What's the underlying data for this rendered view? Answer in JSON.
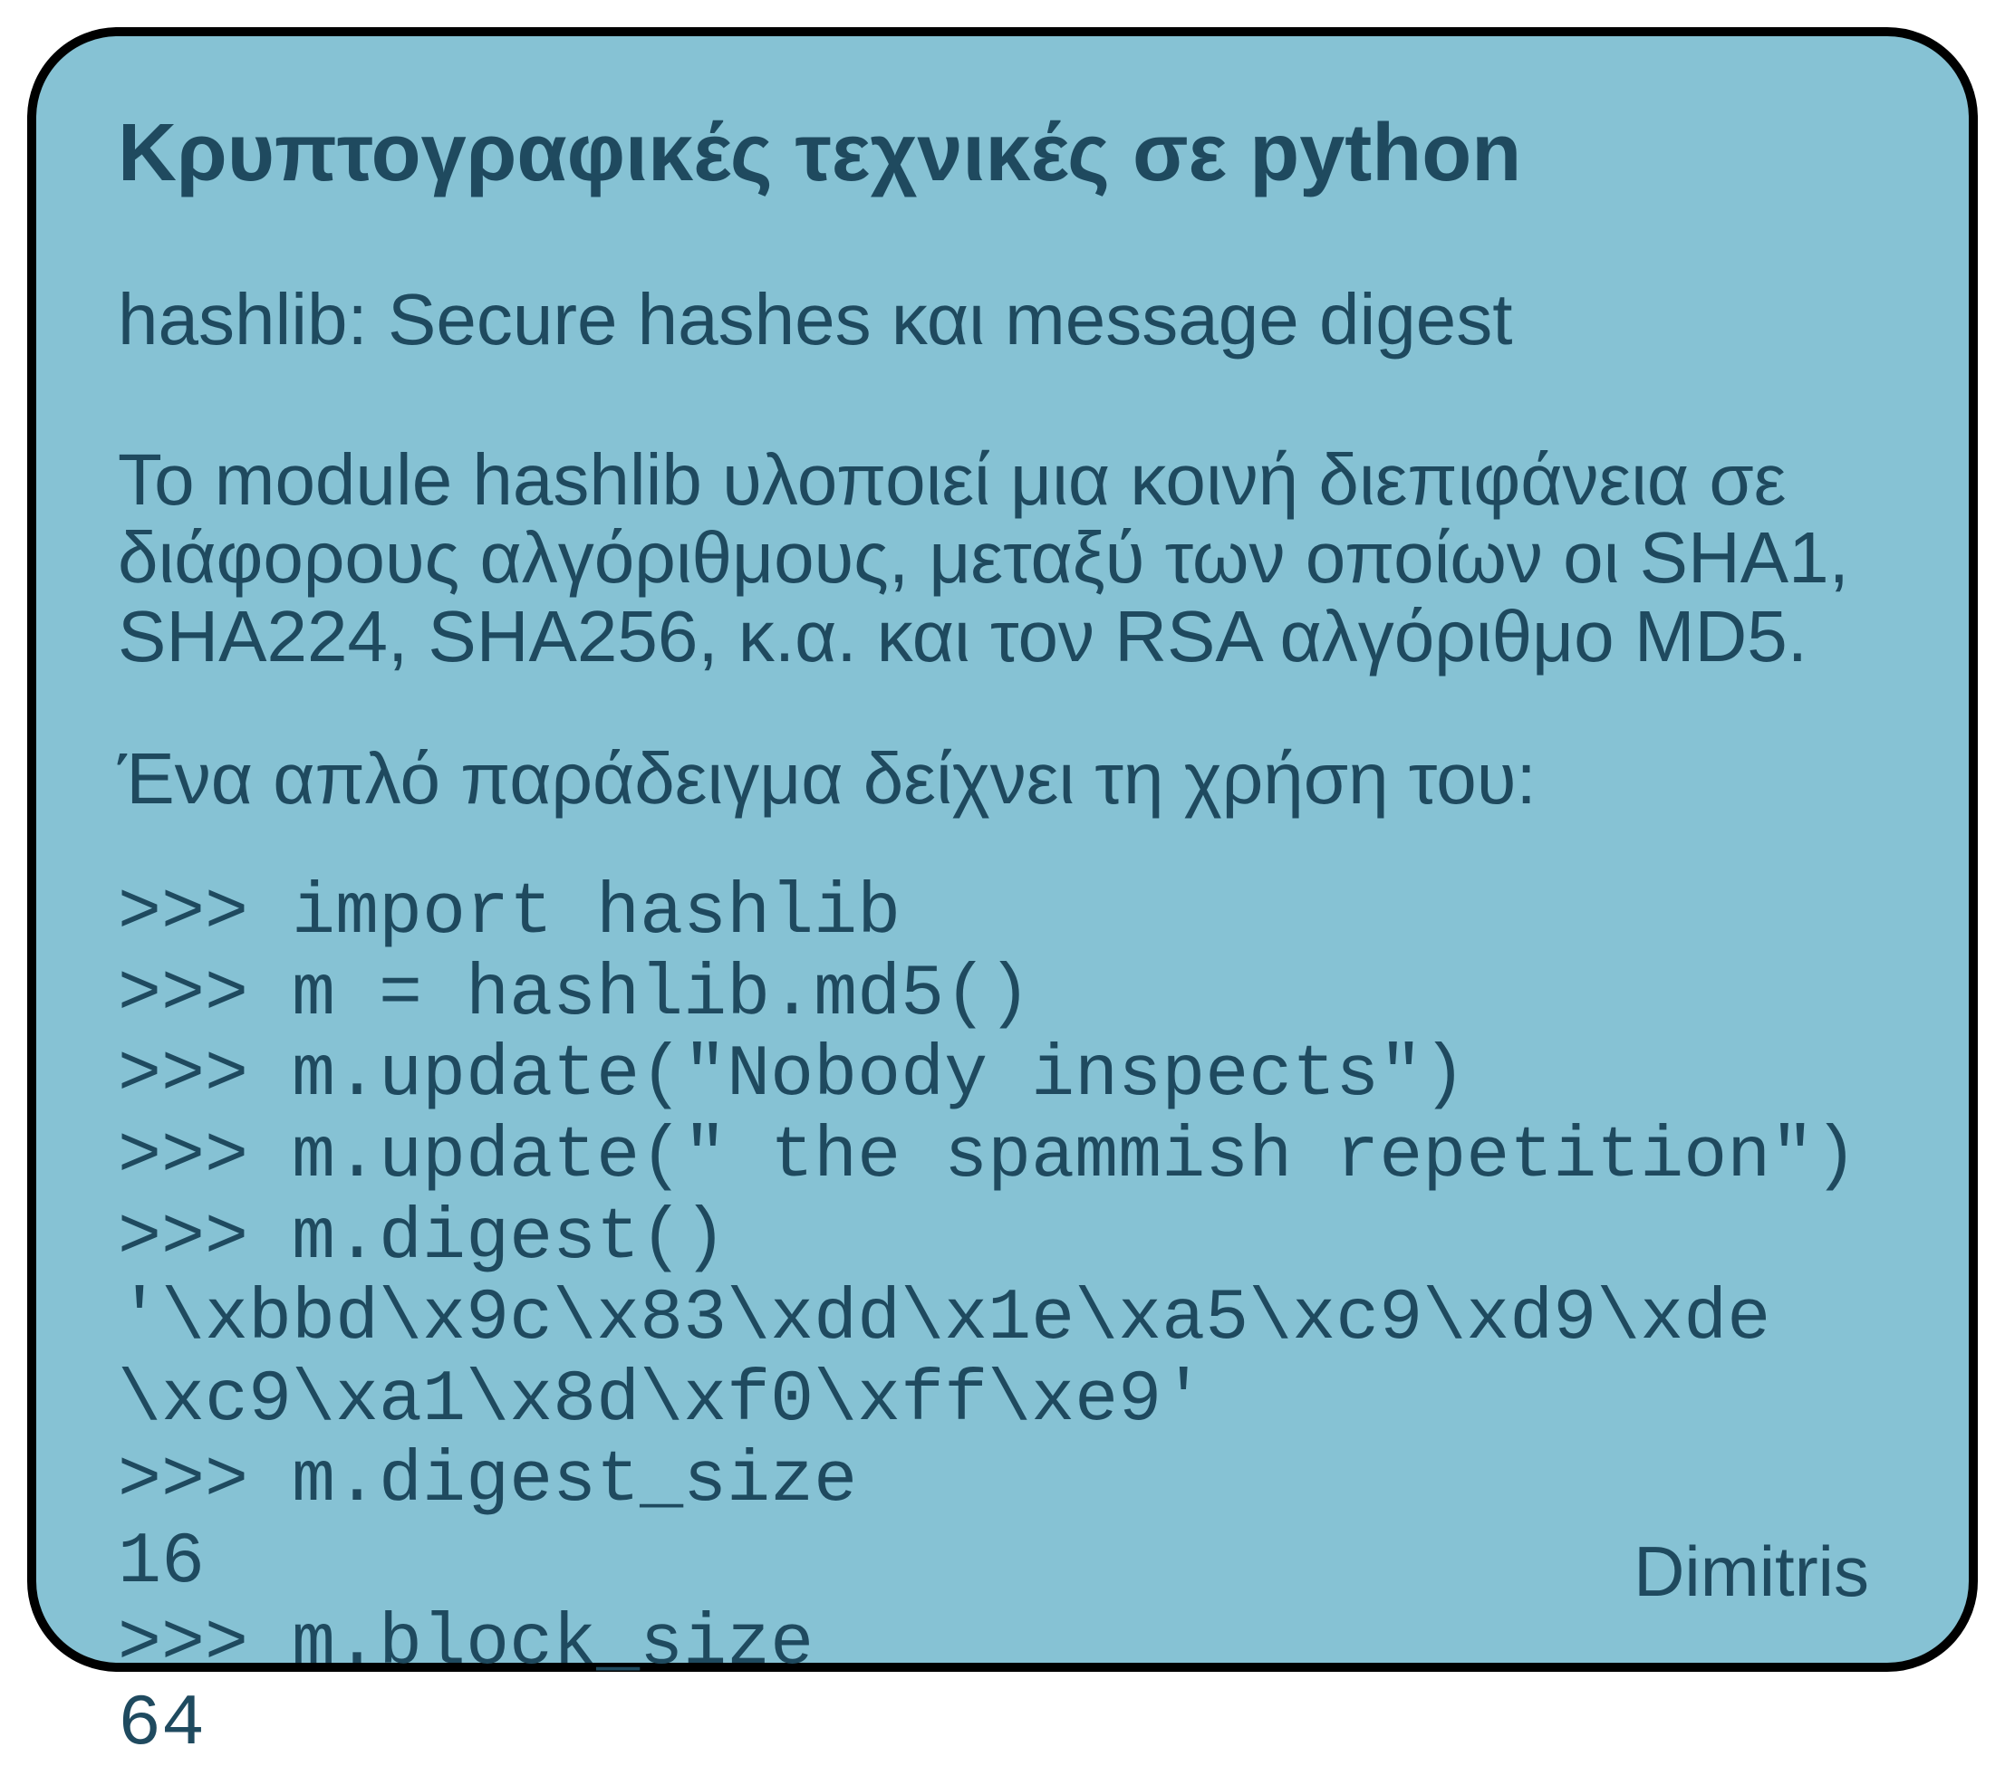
{
  "title": "Κρυπτογραφικές τεχνικές σε python",
  "subtitle": "hashlib: Secure hashes και message digest",
  "paragraph1": "Το module hashlib υλοποιεί μια κοινή διεπιφάνεια σε διάφορους αλγόριθμους, μεταξύ των οποίων οι SHA1, SHA224, SHA256, κ.α. και τον RSA αλγόριθμο MD5.",
  "paragraph2": "Ένα απλό παράδειγμα δείχνει τη χρήση του:",
  "code_lines": [
    ">>> import hashlib",
    ">>> m = hashlib.md5()",
    ">>> m.update(\"Nobody inspects\")",
    ">>> m.update(\" the spammish repetition\")",
    ">>> m.digest()",
    "'\\xbbd\\x9c\\x83\\xdd\\x1e\\xa5\\xc9\\xd9\\xde",
    "\\xc9\\xa1\\x8d\\xf0\\xff\\xe9'",
    ">>> m.digest_size",
    "16",
    ">>> m.block_size",
    "64"
  ],
  "author": "Dimitris"
}
